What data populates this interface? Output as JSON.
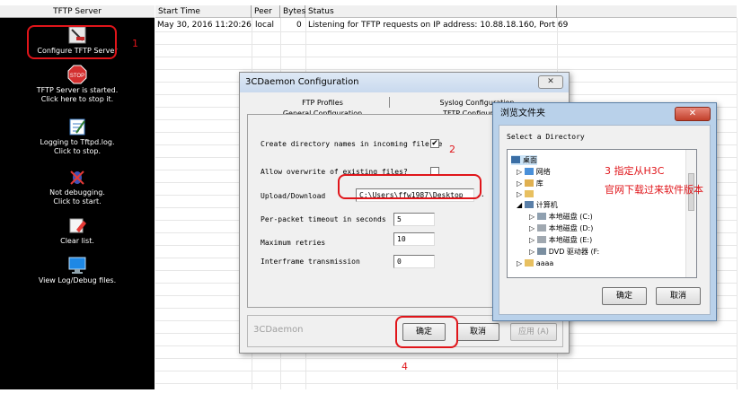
{
  "left_panel": {
    "header": "TFTP Server",
    "items": [
      {
        "icon": "configure-tools-icon",
        "label_lines": [
          "Configure TFTP Server"
        ]
      },
      {
        "icon": "stop-sign-icon",
        "label_lines": [
          "TFTP Server is started.",
          "Click here to stop it."
        ]
      },
      {
        "icon": "notepad-icon",
        "label_lines": [
          "Logging to Tftpd.log.",
          "Click to stop."
        ]
      },
      {
        "icon": "bug-icon",
        "label_lines": [
          "Not debugging.",
          "Click to start."
        ]
      },
      {
        "icon": "eraser-icon",
        "label_lines": [
          "Clear list."
        ]
      },
      {
        "icon": "monitor-icon",
        "label_lines": [
          "View Log/Debug files."
        ]
      }
    ]
  },
  "log_table": {
    "columns": [
      "Start Time",
      "Peer",
      "Bytes",
      "Status"
    ],
    "rows": [
      {
        "start_time": "May 30, 2016 11:20:26",
        "peer": "local",
        "bytes": "0",
        "status": "Listening for TFTP requests on IP address: 10.88.18.160, Port 69"
      }
    ]
  },
  "config_dialog": {
    "title": "3CDaemon Configuration",
    "close": "✕",
    "tabs_back": [
      "FTP Profiles",
      "Syslog Configuration"
    ],
    "tabs_front": [
      "General Configuration",
      "TFTP Configuration"
    ],
    "fields": {
      "create_dirs_label": "Create directory names in incoming file re",
      "create_dirs_checked": "✔",
      "allow_overwrite_label": "Allow overwrite of existing files?",
      "allow_overwrite_checked": "",
      "upload_label": "Upload/Download",
      "upload_value": "C:\\Users\\ffw1987\\Desktop",
      "upload_browse": "..",
      "timeout_label": "Per-packet timeout in seconds",
      "timeout_value": "5",
      "retries_label": "Maximum retries",
      "retries_value": "10",
      "interframe_label": "Interframe transmission",
      "interframe_value": "0"
    },
    "footer_brand": "3CDaemon",
    "ok": "确定",
    "cancel": "取消",
    "apply": "应用 (A)"
  },
  "browse_dialog": {
    "title": "浏览文件夹",
    "close": "✕",
    "prompt": "Select a Directory",
    "tree": [
      {
        "label": "桌面",
        "icon": "desktop-icon",
        "expander": ""
      },
      {
        "label": "网络",
        "icon": "network-icon",
        "expander": "▷"
      },
      {
        "label": "库",
        "icon": "library-icon",
        "expander": "▷"
      },
      {
        "label": "",
        "icon": "user-folder-icon",
        "expander": "▷"
      },
      {
        "label": "计算机",
        "icon": "computer-icon",
        "expander": "◢"
      },
      {
        "label": "本地磁盘 (C:)",
        "icon": "system-drive-icon",
        "expander": "▷"
      },
      {
        "label": "本地磁盘 (D:)",
        "icon": "drive-icon",
        "expander": "▷"
      },
      {
        "label": "本地磁盘 (E:)",
        "icon": "drive-icon",
        "expander": "▷"
      },
      {
        "label": "DVD 驱动器 (F:",
        "icon": "dvd-drive-icon",
        "expander": "▷"
      },
      {
        "label": "aaaa",
        "icon": "folder-icon",
        "expander": "▷"
      }
    ],
    "ok": "确定",
    "cancel": "取消"
  },
  "annotations": {
    "step1": "1",
    "step2": "2",
    "step3_line1": "3 指定从H3C",
    "step3_line2": "官网下载过来软件版本",
    "step4": "4"
  },
  "colors": {
    "annotation_red": "#e0151a",
    "left_panel_bg": "#000000"
  }
}
